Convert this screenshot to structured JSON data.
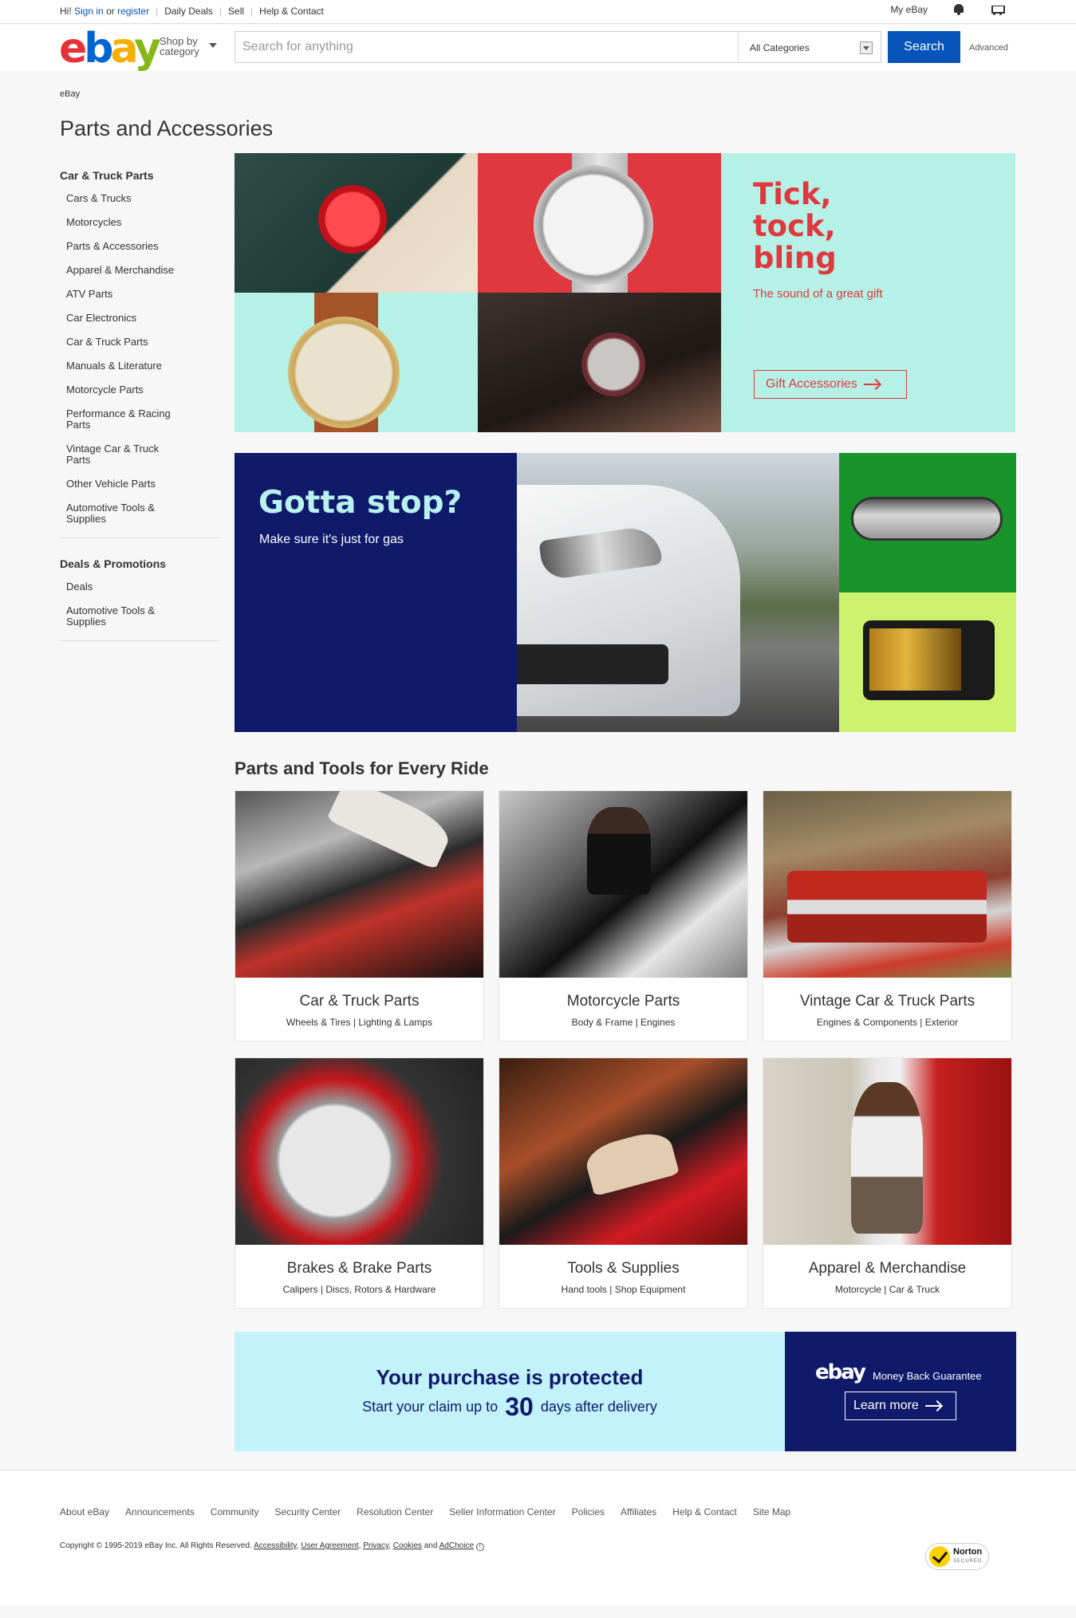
{
  "topbar": {
    "greeting": "Hi!",
    "sign_in": "Sign in",
    "or": "or",
    "register": "register",
    "links": [
      "Daily Deals",
      "Sell",
      "Help & Contact"
    ],
    "my_ebay": "My eBay"
  },
  "header": {
    "shop_by_line1": "Shop by",
    "shop_by_line2": "category",
    "search_placeholder": "Search for anything",
    "category_selected": "All Categories",
    "search_button": "Search",
    "advanced": "Advanced"
  },
  "breadcrumb": "eBay",
  "page_title": "Parts and Accessories",
  "sidebar": {
    "section1_title": "Car & Truck Parts",
    "section1_items": [
      "Cars & Trucks",
      "Motorcycles",
      "Parts & Accessories",
      "Apparel & Merchandise",
      "ATV Parts",
      "Car Electronics",
      "Car & Truck Parts",
      "Manuals & Literature",
      "Motorcycle Parts",
      "Performance & Racing Parts",
      "Vintage Car & Truck Parts",
      "Other Vehicle Parts",
      "Automotive Tools & Supplies"
    ],
    "section2_title": "Deals & Promotions",
    "section2_items": [
      "Deals",
      "Automotive Tools & Supplies"
    ]
  },
  "hero1": {
    "headline": "Tick,\ntock,\nbling",
    "sub": "The sound of a great gift",
    "cta": "Gift Accessories"
  },
  "hero2": {
    "headline": "Gotta stop?",
    "sub": "Make sure it's just for gas"
  },
  "section_title": "Parts and Tools for Every Ride",
  "cards": [
    {
      "title": "Car & Truck Parts",
      "sub": "Wheels & Tires | Lighting & Lamps"
    },
    {
      "title": "Motorcycle Parts",
      "sub": "Body & Frame | Engines"
    },
    {
      "title": "Vintage Car & Truck Parts",
      "sub": "Engines & Components | Exterior"
    },
    {
      "title": "Brakes & Brake Parts",
      "sub": "Calipers | Discs, Rotors & Hardware"
    },
    {
      "title": "Tools & Supplies",
      "sub": "Hand tools | Shop Equipment"
    },
    {
      "title": "Apparel & Merchandise",
      "sub": "Motorcycle | Car & Truck"
    }
  ],
  "guarantee": {
    "headline": "Your purchase is protected",
    "sub_pre": "Start your claim up to",
    "sub_num": "30",
    "sub_post": "days after delivery",
    "brand": "ebay",
    "badge": "Money Back Guarantee",
    "cta": "Learn more"
  },
  "footer": {
    "links": [
      "About eBay",
      "Announcements",
      "Community",
      "Security Center",
      "Resolution Center",
      "Seller Information Center",
      "Policies",
      "Affiliates",
      "Help & Contact",
      "Site Map"
    ],
    "copyright": "Copyright © 1995-2019 eBay Inc. All Rights Reserved.",
    "legal": [
      "Accessibility",
      "User Agreement",
      "Privacy",
      "Cookies"
    ],
    "and": "and",
    "adchoice": "AdChoice",
    "norton": "Norton",
    "norton_sub": "SECURED"
  },
  "colors": {
    "ebay_red": "#e53238",
    "ebay_blue": "#0064d2",
    "ebay_yellow": "#f5af02",
    "ebay_green": "#86b817",
    "search_button": "#0654ba",
    "hero1_red": "#e0383f",
    "hero1_mint": "#b5f1e6",
    "navy": "#0f1a6b",
    "guarantee_bg": "#c2f3fb"
  }
}
